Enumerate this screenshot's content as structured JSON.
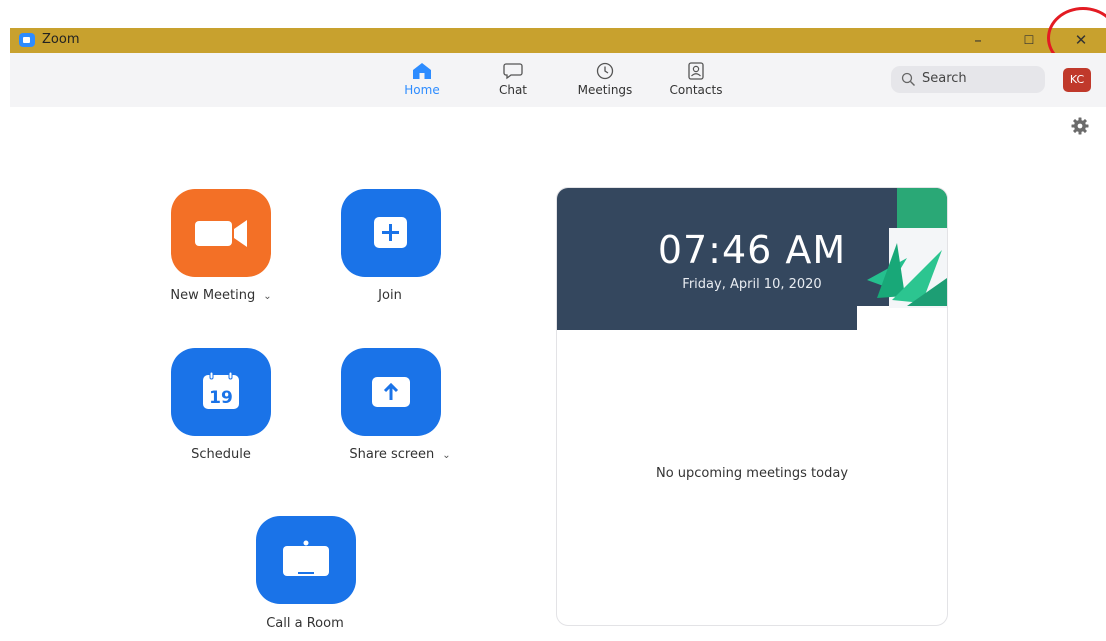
{
  "window": {
    "title": "Zoom",
    "controls": {
      "minimize": "–",
      "maximize": "☐",
      "close": "✕"
    }
  },
  "nav": {
    "tabs": [
      {
        "label": "Home",
        "icon": "home-icon",
        "active": true
      },
      {
        "label": "Chat",
        "icon": "chat-icon"
      },
      {
        "label": "Meetings",
        "icon": "clock-icon"
      },
      {
        "label": "Contacts",
        "icon": "contacts-icon"
      }
    ],
    "search_label": "Search",
    "avatar_initials": "KC"
  },
  "actions": {
    "new_meeting": "New Meeting",
    "join": "Join",
    "schedule": "Schedule",
    "schedule_day": "19",
    "share_screen": "Share screen",
    "call_room": "Call a Room"
  },
  "panel": {
    "time": "07:46 AM",
    "date": "Friday, April 10, 2020",
    "empty_message": "No upcoming meetings today"
  },
  "colors": {
    "titlebar": "#c8a12e",
    "accent_blue": "#1a73e8",
    "new_meeting_orange": "#f37026",
    "avatar_red": "#c0392b"
  }
}
